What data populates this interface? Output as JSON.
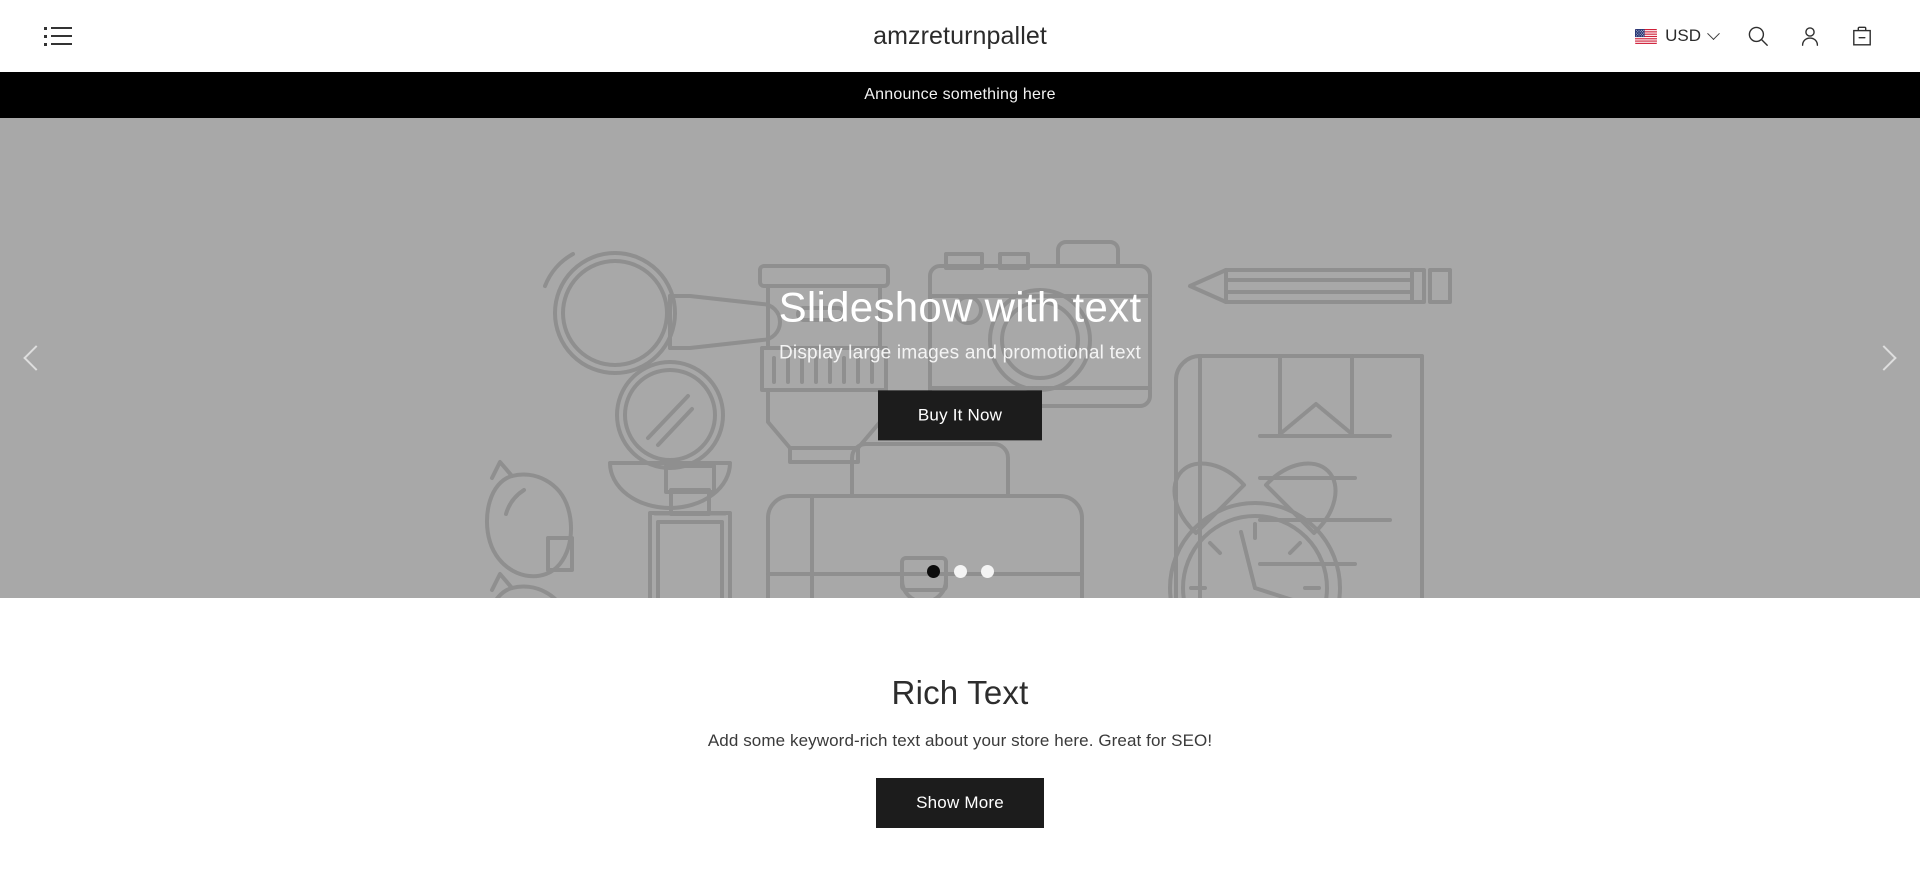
{
  "header": {
    "menu_icon": "hamburger-list-icon",
    "store_title": "amzreturnpallet",
    "currency": {
      "flag": "us-flag-icon",
      "code": "USD",
      "chevron": "chevron-down-icon"
    },
    "icons": {
      "search": "search-icon",
      "account": "account-icon",
      "cart": "shopping-bag-icon"
    }
  },
  "announcement": {
    "text": "Announce something here"
  },
  "slideshow": {
    "heading": "Slideshow with text",
    "subheading": "Display large images and promotional text",
    "cta_label": "Buy It Now",
    "prev_label": "Previous slide",
    "next_label": "Next slide",
    "slide_count": 3,
    "active_slide": 1,
    "background_color": "#a8a8a8",
    "placeholder_line_color": "#8c8c8c",
    "text_color": "#ffffff",
    "cta_background": "#1c1c1c"
  },
  "rich_text": {
    "heading": "Rich Text",
    "body": "Add some keyword-rich text about your store here. Great for SEO!",
    "cta_label": "Show More",
    "cta_background": "#1c1c1c"
  }
}
